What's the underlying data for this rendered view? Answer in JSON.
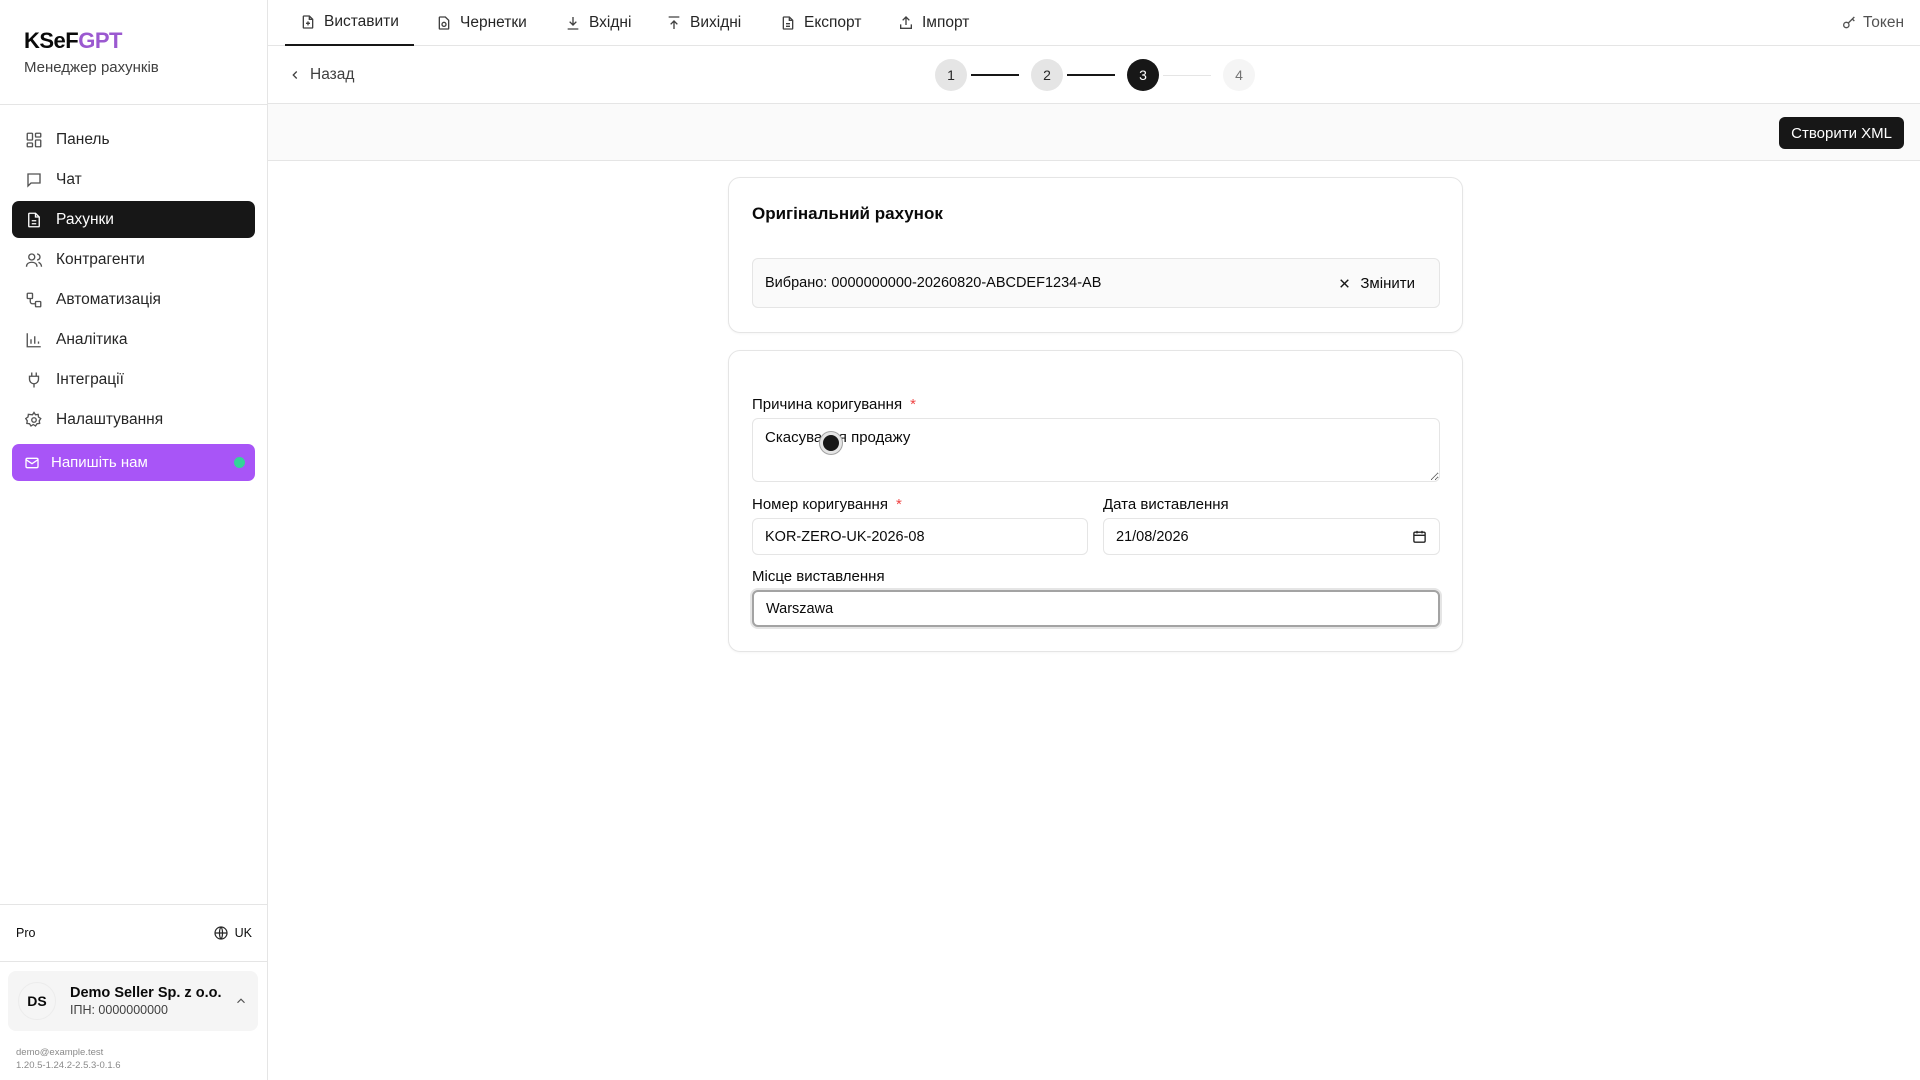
{
  "brand": {
    "name_main": "KSeF",
    "name_accent": "GPT",
    "subtitle": "Менеджер рахунків",
    "accent_color": "#9b59d0"
  },
  "sidebar": {
    "items": [
      {
        "label": "Панель",
        "icon": "dashboard-icon",
        "active": false
      },
      {
        "label": "Чат",
        "icon": "chat-icon",
        "active": false
      },
      {
        "label": "Рахунки",
        "icon": "invoice-icon",
        "active": true
      },
      {
        "label": "Контрагенти",
        "icon": "users-icon",
        "active": false
      },
      {
        "label": "Автоматизація",
        "icon": "workflow-icon",
        "active": false
      },
      {
        "label": "Аналітика",
        "icon": "chart-icon",
        "active": false
      },
      {
        "label": "Інтеграції",
        "icon": "plug-icon",
        "active": false
      },
      {
        "label": "Налаштування",
        "icon": "gear-icon",
        "active": false
      }
    ],
    "contact_button": "Напишіть нам",
    "plan": "Pro",
    "language": "UK",
    "account": {
      "initials": "DS",
      "name": "Demo Seller Sp. z o.o.",
      "tax_id": "ІПН: 0000000000"
    },
    "email": "demo@example.test",
    "version": "1.20.5-1.24.2-2.5.3-0.1.6"
  },
  "tabs": [
    {
      "label": "Виставити",
      "icon": "file-plus-icon",
      "active": true
    },
    {
      "label": "Чернетки",
      "icon": "draft-icon",
      "active": false
    },
    {
      "label": "Вхідні",
      "icon": "download-icon",
      "active": false
    },
    {
      "label": "Вихідні",
      "icon": "upload-icon",
      "active": false
    },
    {
      "label": "Експорт",
      "icon": "file-export-icon",
      "active": false
    },
    {
      "label": "Імпорт",
      "icon": "import-icon",
      "active": false
    }
  ],
  "token_label": "Токен",
  "back_label": "Назад",
  "stepper": {
    "steps": [
      "1",
      "2",
      "3",
      "4"
    ],
    "current": 3
  },
  "actions": {
    "create_xml": "Створити XML"
  },
  "original_invoice": {
    "title": "Оригінальний рахунок",
    "selected_text": "Вибрано: 0000000000-20260820-ABCDEF1234-AB",
    "change_label": "Змінити"
  },
  "form": {
    "reason_label": "Причина коригування",
    "reason_value": "Скасування продажу",
    "number_label": "Номер коригування",
    "number_value": "KOR-ZERO-UK-2026-08",
    "date_label": "Дата виставлення",
    "date_value": "21/08/2026",
    "place_label": "Місце виставлення",
    "place_value": "Warszawa"
  }
}
